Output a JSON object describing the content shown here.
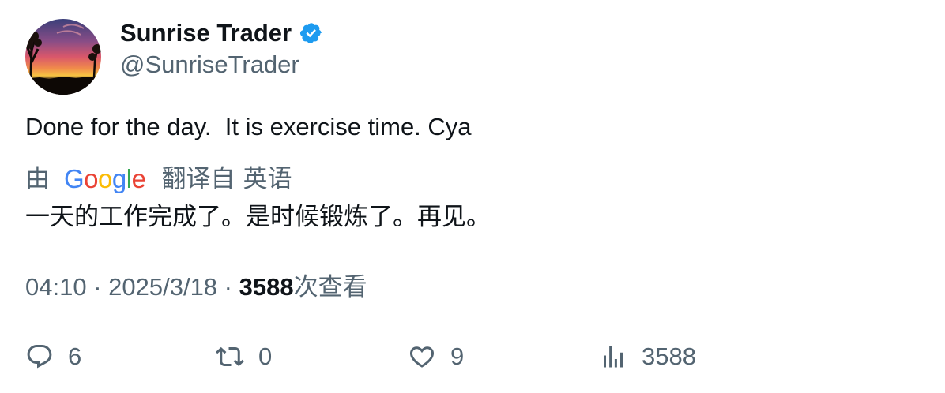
{
  "user": {
    "display_name": "Sunrise Trader",
    "handle": "@SunriseTrader",
    "verified": true
  },
  "tweet": {
    "text": "Done for the day.  It is exercise time. Cya"
  },
  "translation": {
    "by_label": "由",
    "google_letters": [
      "G",
      "o",
      "o",
      "g",
      "l",
      "e"
    ],
    "translated_from": "翻译自",
    "language": "英语",
    "text": "一天的工作完成了。是时候锻炼了。再见。"
  },
  "meta": {
    "time": "04:10",
    "separator": " · ",
    "date": "2025/3/18",
    "views_count": "3588",
    "views_label": "次查看"
  },
  "actions": {
    "reply_count": "6",
    "retweet_count": "0",
    "like_count": "9",
    "views_count": "3588"
  },
  "colors": {
    "verified_blue": "#1d9bf0",
    "secondary_text": "#536471",
    "primary_text": "#0f1419",
    "google_blue": "#4285f4",
    "google_red": "#ea4335",
    "google_yellow": "#fbbc05",
    "google_green": "#34a853"
  }
}
